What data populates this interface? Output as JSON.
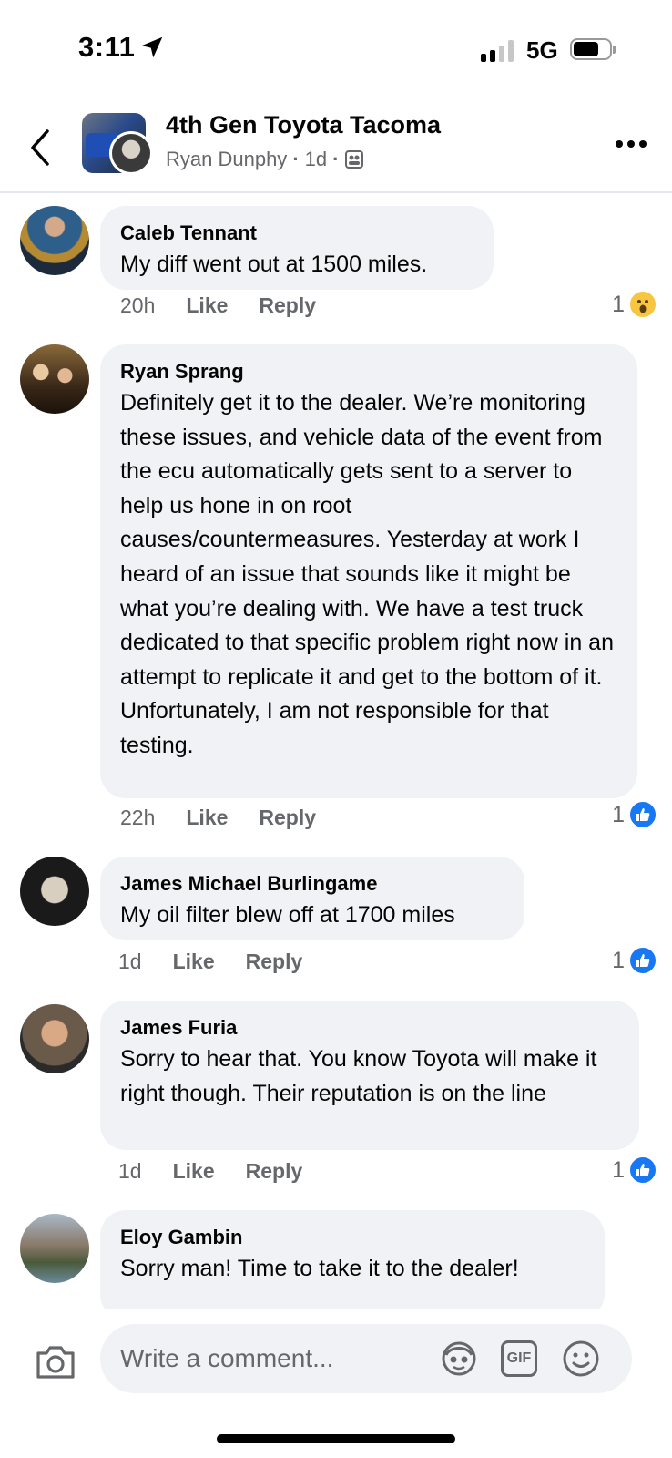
{
  "status_bar": {
    "time": "3:11",
    "network": "5G"
  },
  "header": {
    "title": "4th Gen Toyota Tacoma",
    "author": "Ryan Dunphy",
    "time": "1d",
    "separator": "·"
  },
  "comments": [
    {
      "name": "Caleb Tennant",
      "text": "My diff went out at 1500 miles.",
      "time": "20h",
      "like_label": "Like",
      "reply_label": "Reply",
      "reaction_count": "1",
      "reaction_icon": "wow-emoji-icon"
    },
    {
      "name": "Ryan Sprang",
      "text": "Definitely get it to the dealer. We’re monitoring these issues, and vehicle data of the event from the ecu automatically gets sent to a server to help us hone in on root causes/countermeasures. Yesterday at work I heard of an issue that sounds like it might be what you’re dealing with. We have a test truck dedicated to that specific problem right now in an attempt to replicate it and get to the bottom of it. Unfortunately, I am not responsible for that testing.",
      "time": "22h",
      "like_label": "Like",
      "reply_label": "Reply",
      "reaction_count": "1",
      "reaction_icon": "like-reaction-icon"
    },
    {
      "name": "James Michael Burlingame",
      "text": "My oil filter blew off at 1700 miles",
      "time": "1d",
      "like_label": "Like",
      "reply_label": "Reply",
      "reaction_count": "1",
      "reaction_icon": "like-reaction-icon"
    },
    {
      "name": "James Furia",
      "text": "Sorry to hear that. You know Toyota will make it right though. Their reputation is on the line",
      "time": "1d",
      "like_label": "Like",
      "reply_label": "Reply",
      "reaction_count": "1",
      "reaction_icon": "like-reaction-icon"
    },
    {
      "name": "Eloy Gambin",
      "text": "Sorry man! Time to take it to the dealer!"
    }
  ],
  "comment_bar": {
    "placeholder": "Write a comment...",
    "gif_label": "GIF"
  },
  "colors": {
    "accent": "#1877f2",
    "bubble": "#f0f2f5",
    "secondary_text": "#65676b"
  }
}
